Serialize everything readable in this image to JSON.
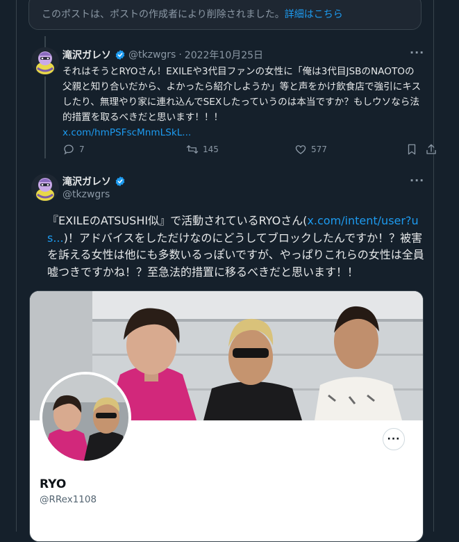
{
  "deleted_notice": {
    "text": "このポストは、ポストの作成者により削除されました。",
    "link": "詳細はこちら"
  },
  "tweet1": {
    "name": "滝沢ガレソ",
    "handle": "@tkzwgrs",
    "separator": "·",
    "date": "2022年10月25日",
    "text": "それはそうとRYOさん！EXILEや3代目ファンの女性に「俺は3代目JSBのNAOTOの父親と知り合いだから、よかったら紹介しようか」等と声をかけ飲食店で強引にキスしたり、無理やり家に連れ込んでSEXしたっていうのは本当ですか？もしウソなら法的措置を取るべきだと思います！！！",
    "link": "x.com/hmPSFscMnmLSkL...",
    "replies": "7",
    "retweets": "145",
    "likes": "577"
  },
  "tweet2": {
    "name": "滝沢ガレソ",
    "handle": "@tkzwgrs",
    "text_before": "『EXILEのATSUSHI似』で活動されているRYOさん(",
    "link": "x.com/intent/user?us...",
    "text_after": ")！アドバイスをしただけなのにどうしてブロックしたんですか！？被害を訴える女性は他にも多数いるっぽいですが、やっぱりこれらの女性は全員嘘つきですかね！？至急法的措置に移るべきだと思います！！"
  },
  "profile_card": {
    "name": "RYO",
    "handle": "@RRex1108"
  },
  "icons": {
    "more": "more-icon",
    "verified": "verified-icon",
    "reply": "reply-icon",
    "retweet": "retweet-icon",
    "like": "heart-icon",
    "bookmark": "bookmark-icon",
    "share": "share-icon"
  },
  "colors": {
    "background": "#15202b",
    "accent": "#1d9bf0",
    "secondary_text": "#8b98a5"
  }
}
